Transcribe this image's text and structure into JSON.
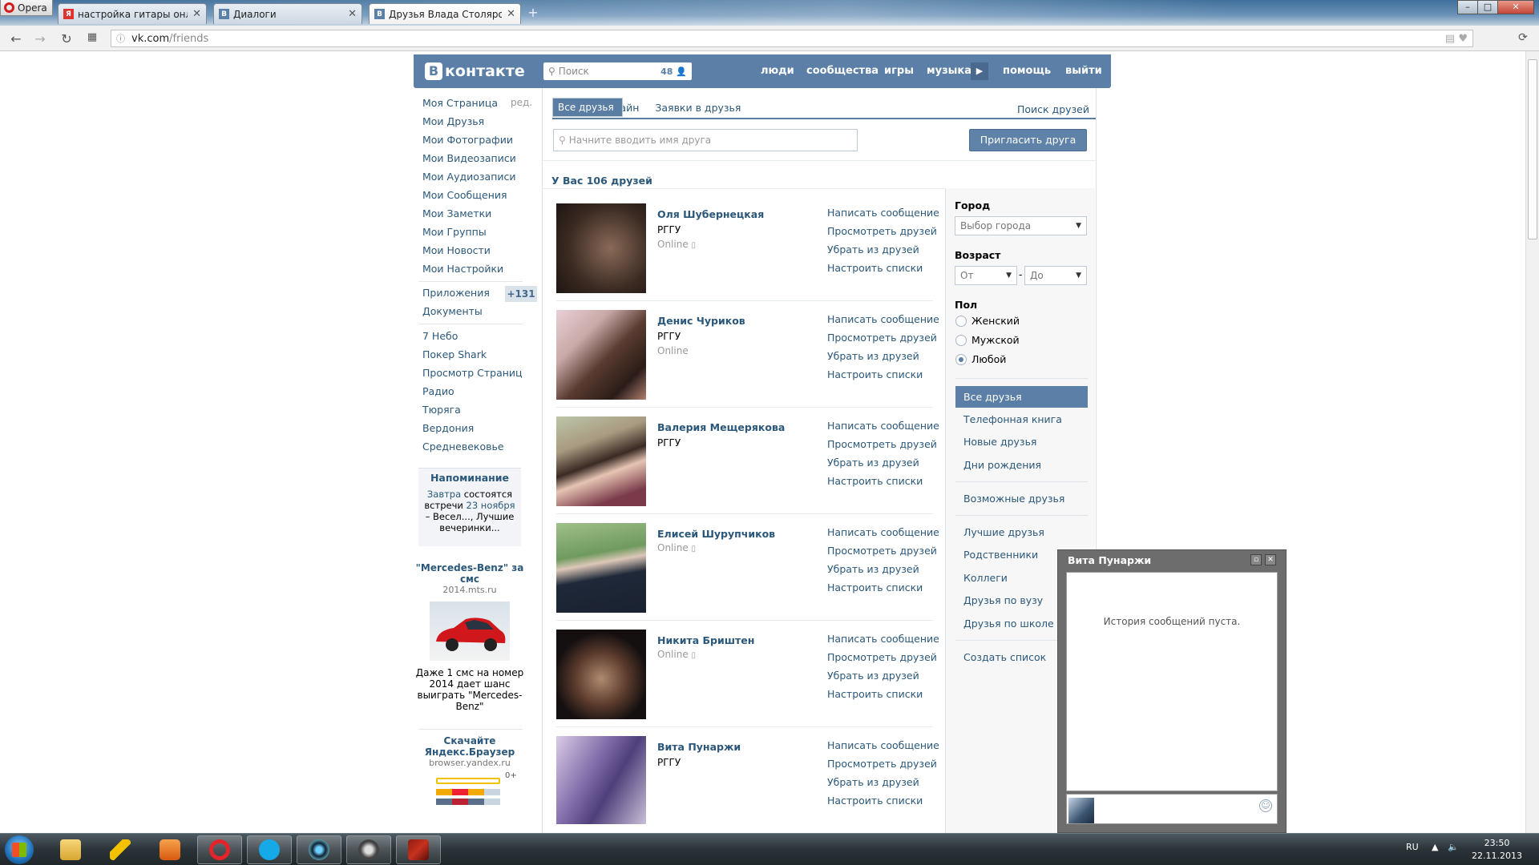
{
  "browser": {
    "menu_label": "Opera",
    "tabs": [
      {
        "title": "настройка гитары онлайн",
        "favicon": "Я"
      },
      {
        "title": "Диалоги",
        "favicon": "B"
      },
      {
        "title": "Друзья Влада Столярова",
        "favicon": "B"
      }
    ],
    "url_host": "vk.com",
    "url_path": "/friends"
  },
  "header": {
    "logo_text": "контакте",
    "logo_letter": "В",
    "search_placeholder": "Поиск",
    "search_count": "48",
    "nav": [
      "люди",
      "сообщества",
      "игры",
      "музыка",
      "помощь",
      "выйти"
    ]
  },
  "left_menu": {
    "edit_label": "ред.",
    "main_items": [
      "Моя Страница",
      "Мои Друзья",
      "Мои Фотографии",
      "Мои Видеозаписи",
      "Мои Аудиозаписи",
      "Мои Сообщения",
      "Мои Заметки",
      "Мои Группы",
      "Мои Новости",
      "Мои Настройки"
    ],
    "apps_label": "Приложения",
    "apps_badge": "+131",
    "docs_label": "Документы",
    "app_items": [
      "7 Небо",
      "Покер Shark",
      "Просмотр Страниц",
      "Радио",
      "Тюряга",
      "Вердония",
      "Средневековье"
    ]
  },
  "reminder": {
    "title": "Напоминание",
    "p1": "Завтра",
    "p2": " состоятся встречи ",
    "p3": "23 ноября",
    "p4": " – Весел..., Лучшие вечеринки..."
  },
  "ads": [
    {
      "title": "\"Mercedes-Benz\" за смс",
      "url": "2014.mts.ru",
      "text": "Даже 1 смс на номер 2014 дает шанс выиграть \"Mercedes-Benz\""
    },
    {
      "title": "Скачайте Яндекс.Браузер",
      "url": "browser.yandex.ru",
      "extra": "0+"
    }
  ],
  "friends_page": {
    "tabs": [
      "Все друзья",
      "Друзья онлайн",
      "Заявки в друзья"
    ],
    "search_friends_link": "Поиск друзей",
    "filter_placeholder": "Начните вводить имя друга",
    "invite_button": "Пригласить друга",
    "count_text": "У Вас 106 друзей",
    "actions": [
      "Написать сообщение",
      "Просмотреть друзей",
      "Убрать из друзей",
      "Настроить списки"
    ],
    "friends": [
      {
        "name": "Оля Шубернецкая",
        "uni": "РГГУ",
        "online": "Online",
        "mobile": true
      },
      {
        "name": "Денис Чуриков",
        "uni": "РГГУ",
        "online": "Online",
        "mobile": false
      },
      {
        "name": "Валерия Мещерякова",
        "uni": "РГГУ",
        "online": "",
        "mobile": false
      },
      {
        "name": "Елисей Шурупчиков",
        "uni": "",
        "online": "Online",
        "mobile": true
      },
      {
        "name": "Никита Бриштен",
        "uni": "",
        "online": "Online",
        "mobile": true
      },
      {
        "name": "Вита Пунаржи",
        "uni": "РГГУ",
        "online": "",
        "mobile": false
      }
    ]
  },
  "filters": {
    "city_label": "Город",
    "city_select": "Выбор города",
    "age_label": "Возраст",
    "age_from": "От",
    "age_dash": "-",
    "age_to": "До",
    "sex_label": "Пол",
    "sex_options": [
      "Женский",
      "Мужской",
      "Любой"
    ],
    "sex_selected": "Любой",
    "lists": [
      "Все друзья",
      "Телефонная книга",
      "Новые друзья",
      "Дни рождения",
      "Возможные друзья",
      "Лучшие друзья",
      "Родственники",
      "Коллеги",
      "Друзья по вузу",
      "Друзья по школе",
      "Создать список"
    ]
  },
  "chat": {
    "title": "Вита Пунаржи",
    "empty_text": "История сообщений пуста."
  },
  "taskbar": {
    "lang": "RU",
    "time": "23:50",
    "date": "22.11.2013"
  },
  "colors": {
    "vk_blue": "#5b7fa6",
    "link": "#2b587a"
  }
}
